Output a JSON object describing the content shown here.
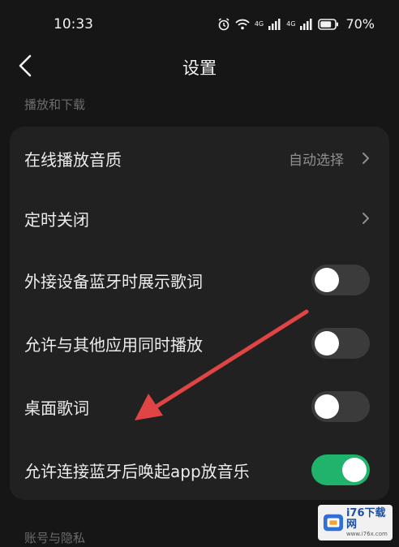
{
  "status_bar": {
    "time": "10:33",
    "signal_label_1": "4G",
    "signal_label_2": "4G",
    "battery": "70%"
  },
  "header": {
    "title": "设置",
    "back_icon": "chevron-left-icon"
  },
  "sections": [
    {
      "label": "播放和下载",
      "items": [
        {
          "label": "在线播放音质",
          "type": "link",
          "value": "自动选择"
        },
        {
          "label": "定时关闭",
          "type": "link"
        },
        {
          "label": "外接设备蓝牙时展示歌词",
          "type": "toggle",
          "on": false
        },
        {
          "label": "允许与其他应用同时播放",
          "type": "toggle",
          "on": false
        },
        {
          "label": "桌面歌词",
          "type": "toggle",
          "on": false
        },
        {
          "label": "允许连接蓝牙后唤起app放音乐",
          "type": "toggle",
          "on": true
        }
      ]
    },
    {
      "label": "账号与隐私"
    }
  ],
  "annotation": {
    "type": "red-arrow",
    "color": "#e04444"
  },
  "colors": {
    "background": "#161616",
    "card": "#212121",
    "toggle_off": "#3b3b3b",
    "toggle_on": "#1fb36b"
  },
  "watermark": {
    "main": "i76下载网",
    "sub": "www.i76x.com"
  }
}
